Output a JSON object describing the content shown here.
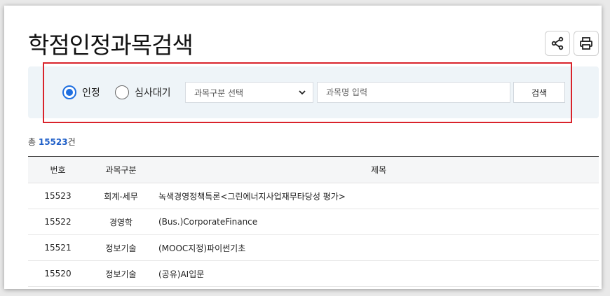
{
  "page": {
    "title": "학점인정과목검색"
  },
  "tools": {
    "share_icon": "share-icon",
    "print_icon": "printer-icon"
  },
  "search": {
    "radios": [
      {
        "label": "인정",
        "checked": true
      },
      {
        "label": "심사대기",
        "checked": false
      }
    ],
    "category_select": {
      "value": "과목구분 선택"
    },
    "keyword_input": {
      "value": "",
      "placeholder": "과목명 입력"
    },
    "search_label": "검색"
  },
  "summary": {
    "prefix": "총 ",
    "count": "15523",
    "suffix": "건"
  },
  "table": {
    "headers": [
      "번호",
      "과목구분",
      "제목"
    ],
    "rows": [
      {
        "no": "15523",
        "category": "회계-세무",
        "title": "녹색경영정책특론<그린에너지사업재무타당성 평가>"
      },
      {
        "no": "15522",
        "category": "경영학",
        "title": "(Bus.)CorporateFinance"
      },
      {
        "no": "15521",
        "category": "정보기술",
        "title": "(MOOC지정)파이썬기초"
      },
      {
        "no": "15520",
        "category": "정보기술",
        "title": "(공유)AI입문"
      }
    ]
  },
  "colors": {
    "accent": "#1f6fe0",
    "highlight": "#d9232b",
    "count": "#1f5fc8",
    "panel_bg": "#eef4f8"
  }
}
